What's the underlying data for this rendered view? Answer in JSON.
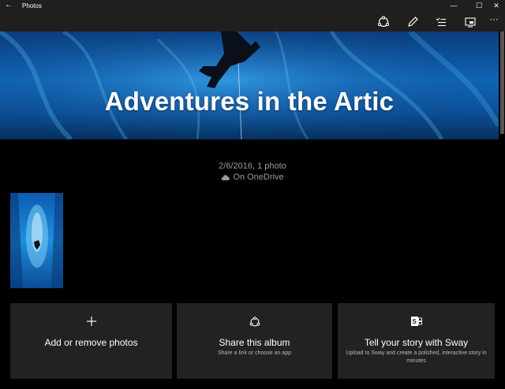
{
  "window": {
    "title": "Photos",
    "back_icon": "←",
    "minimize_icon": "—",
    "maximize_icon": "☐",
    "close_icon": "✕"
  },
  "toolbar": {
    "icons": [
      "share-icon",
      "edit-icon",
      "select-icon",
      "slideshow-icon",
      "more-icon"
    ],
    "more_label": "···"
  },
  "album": {
    "title": "Adventures in the Artic",
    "meta": "2/6/2016, 1 photo",
    "location": "On OneDrive"
  },
  "cards": [
    {
      "label": "Add or remove photos",
      "sub": "",
      "icon": "plus-icon"
    },
    {
      "label": "Share this album",
      "sub": "Share a link or choose an app",
      "icon": "share-icon"
    },
    {
      "label": "Tell your story with Sway",
      "sub": "Upload to Sway and create a polished, interactive story in minutes",
      "icon": "sway-icon"
    }
  ],
  "colors": {
    "titlebar": "#1f1f1f",
    "card": "#222222",
    "background": "#000000",
    "hero_blue": "#0f66b8"
  }
}
